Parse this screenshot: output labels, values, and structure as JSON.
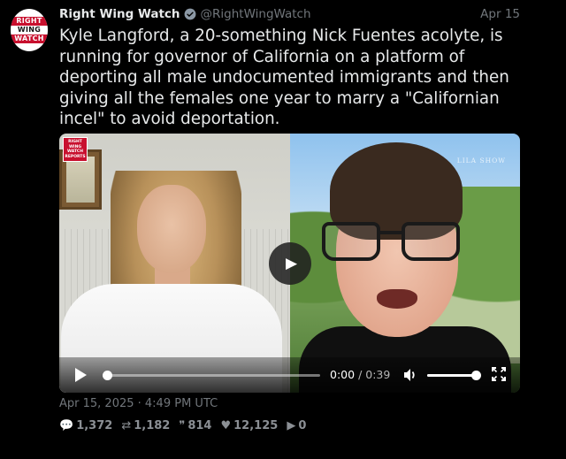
{
  "avatar": {
    "line1": "RIGHT",
    "line2": "WING",
    "line3": "WATCH"
  },
  "author": {
    "display_name": "Right Wing Watch",
    "handle": "@RightWingWatch",
    "verified_icon": "verified-badge-icon",
    "verified_color": "#8b98a5"
  },
  "date": "Apr 15",
  "tweet_text": "Kyle Langford, a 20-something Nick Fuentes acolyte, is running for governor of California on a platform of deporting all male undocumented immigrants and then giving all the females one year to marry a \"Californian incel\" to avoid deportation.",
  "media": {
    "badge": {
      "line1": "RIGHT",
      "line2": "WING",
      "line3": "WATCH",
      "line4": "REPORTS"
    },
    "watermark": "LILA SHOW",
    "progress": 0.0,
    "volume": 1.0,
    "current_time": "0:00",
    "separator": "/",
    "duration": "0:39",
    "play_icon": "play-icon",
    "volume_icon": "volume-icon",
    "fullscreen_icon": "fullscreen-icon"
  },
  "timestamp": "Apr 15, 2025 · 4:49 PM UTC",
  "stats": {
    "replies": "1,372",
    "retweets": "1,182",
    "quotes": "814",
    "likes": "12,125",
    "views": "0"
  },
  "colors": {
    "background": "#000000",
    "text": "#e7e9ea",
    "muted": "#71767b",
    "brand_red": "#c8102e"
  }
}
